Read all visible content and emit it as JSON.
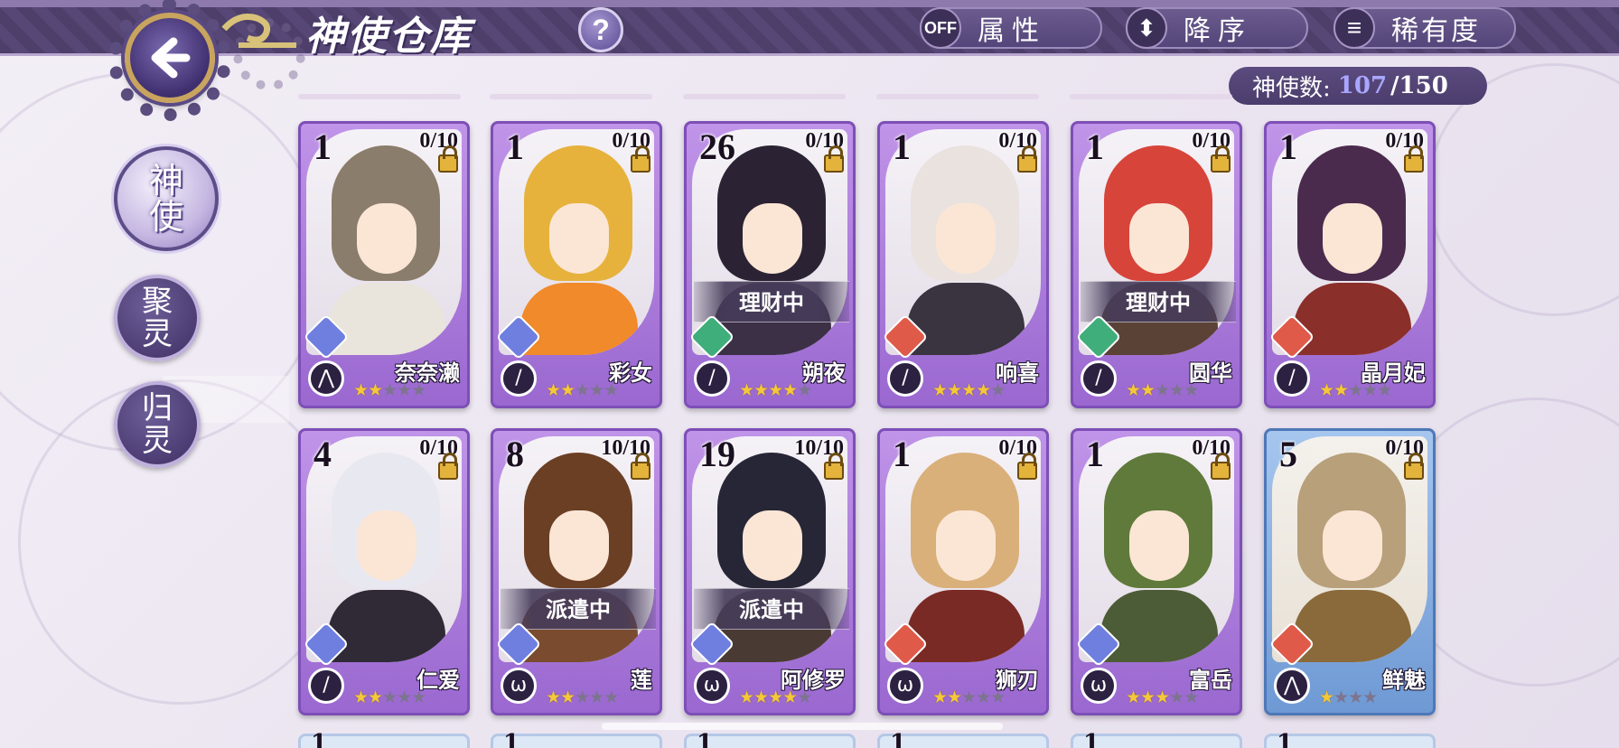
{
  "header": {
    "title": "神使仓库",
    "help": "?",
    "filters": [
      {
        "icon_text": "OFF",
        "label": "属性",
        "icon": "toggle-off-icon"
      },
      {
        "icon_text": "⬍",
        "label": "降序",
        "icon": "sort-order-icon"
      },
      {
        "icon_text": "≡",
        "label": "稀有度",
        "icon": "sort-list-icon"
      }
    ],
    "count_label": "神使数:",
    "count_current": "107",
    "count_max": "/150"
  },
  "sidebar": {
    "items": [
      {
        "label": "神使",
        "active": true
      },
      {
        "label": "聚灵",
        "active": false
      },
      {
        "label": "归灵",
        "active": false
      }
    ]
  },
  "cards": [
    {
      "level": "1",
      "limit": "0/10",
      "name": "奈奈濑",
      "stars": 2,
      "max_stars": 5,
      "element": "#6f7fe0",
      "weapon": "bow",
      "status": "",
      "hair": "#8b7d6b",
      "outfit": "#e9e4dc",
      "frame": "purple"
    },
    {
      "level": "1",
      "limit": "0/10",
      "name": "彩女",
      "stars": 2,
      "max_stars": 5,
      "element": "#6f7fe0",
      "weapon": "sword",
      "status": "",
      "hair": "#e6b23c",
      "outfit": "#f08a2a",
      "frame": "purple"
    },
    {
      "level": "26",
      "limit": "0/10",
      "name": "朔夜",
      "stars": 4,
      "max_stars": 5,
      "element": "#3fae7a",
      "weapon": "sword",
      "status": "理财中",
      "hair": "#2b2333",
      "outfit": "#3b3046",
      "frame": "purple"
    },
    {
      "level": "1",
      "limit": "0/10",
      "name": "响喜",
      "stars": 4,
      "max_stars": 5,
      "element": "#e05a4a",
      "weapon": "sword",
      "status": "",
      "hair": "#e9e2df",
      "outfit": "#3a3340",
      "frame": "purple"
    },
    {
      "level": "1",
      "limit": "0/10",
      "name": "圆华",
      "stars": 2,
      "max_stars": 5,
      "element": "#3fae7a",
      "weapon": "sword",
      "status": "理财中",
      "hair": "#d7443a",
      "outfit": "#5a4236",
      "frame": "purple"
    },
    {
      "level": "1",
      "limit": "0/10",
      "name": "晶月妃",
      "stars": 2,
      "max_stars": 5,
      "element": "#e05a4a",
      "weapon": "sword",
      "status": "",
      "hair": "#4a2b4d",
      "outfit": "#8a2f2a",
      "frame": "purple"
    },
    {
      "level": "4",
      "limit": "0/10",
      "name": "仁爱",
      "stars": 2,
      "max_stars": 5,
      "element": "#6f7fe0",
      "weapon": "sword",
      "status": "",
      "hair": "#e8e8f0",
      "outfit": "#2f2a36",
      "frame": "purple"
    },
    {
      "level": "8",
      "limit": "10/10",
      "name": "莲",
      "stars": 2,
      "max_stars": 5,
      "element": "#6f7fe0",
      "weapon": "beast",
      "status": "派遣中",
      "hair": "#6b3f24",
      "outfit": "#7a4b2f",
      "frame": "purple"
    },
    {
      "level": "19",
      "limit": "10/10",
      "name": "阿修罗",
      "stars": 4,
      "max_stars": 5,
      "element": "#6f7fe0",
      "weapon": "beast",
      "status": "派遣中",
      "hair": "#262636",
      "outfit": "#4a3a34",
      "frame": "purple"
    },
    {
      "level": "1",
      "limit": "0/10",
      "name": "狮刃",
      "stars": 2,
      "max_stars": 5,
      "element": "#e05a4a",
      "weapon": "beast",
      "status": "",
      "hair": "#d9b07a",
      "outfit": "#7a2a24",
      "frame": "purple"
    },
    {
      "level": "1",
      "limit": "0/10",
      "name": "富岳",
      "stars": 3,
      "max_stars": 5,
      "element": "#6f7fe0",
      "weapon": "beast",
      "status": "",
      "hair": "#5f7a3a",
      "outfit": "#4c5c36",
      "frame": "purple"
    },
    {
      "level": "5",
      "limit": "0/10",
      "name": "鲜魅",
      "stars": 1,
      "max_stars": 4,
      "element": "#e05a4a",
      "weapon": "bow",
      "status": "",
      "hair": "#b7a07a",
      "outfit": "#8a6a3a",
      "frame": "blue"
    }
  ],
  "next_row_levels": [
    "1",
    "1",
    "1",
    "1",
    "1",
    "1"
  ]
}
